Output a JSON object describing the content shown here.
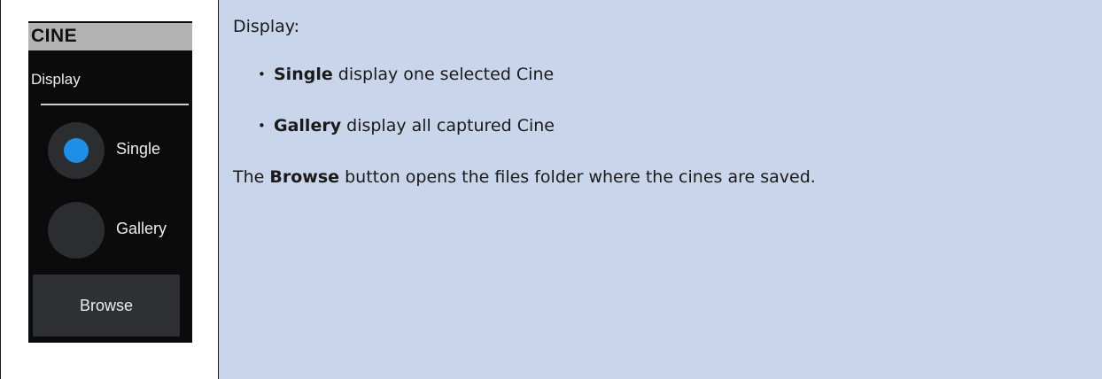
{
  "panel": {
    "title": "CINE",
    "section_label": "Display",
    "options": [
      {
        "label": "Single",
        "selected": true
      },
      {
        "label": "Gallery",
        "selected": false
      }
    ],
    "browse_label": "Browse",
    "colors": {
      "background": "#0b0b0b",
      "header": "#b3b3b3",
      "accent": "#1f8ee6",
      "radio": "#2b2d31",
      "button": "#2e3034"
    }
  },
  "description": {
    "heading": "Display:",
    "bullets": [
      {
        "term": "Single",
        "text": " display one selected Cine"
      },
      {
        "term": "Gallery",
        "text": " display all captured Cine"
      }
    ],
    "outro_prefix": "The ",
    "outro_term": "Browse",
    "outro_suffix": " button opens the files folder where the cines are saved.",
    "background": "#c9d5ea"
  }
}
